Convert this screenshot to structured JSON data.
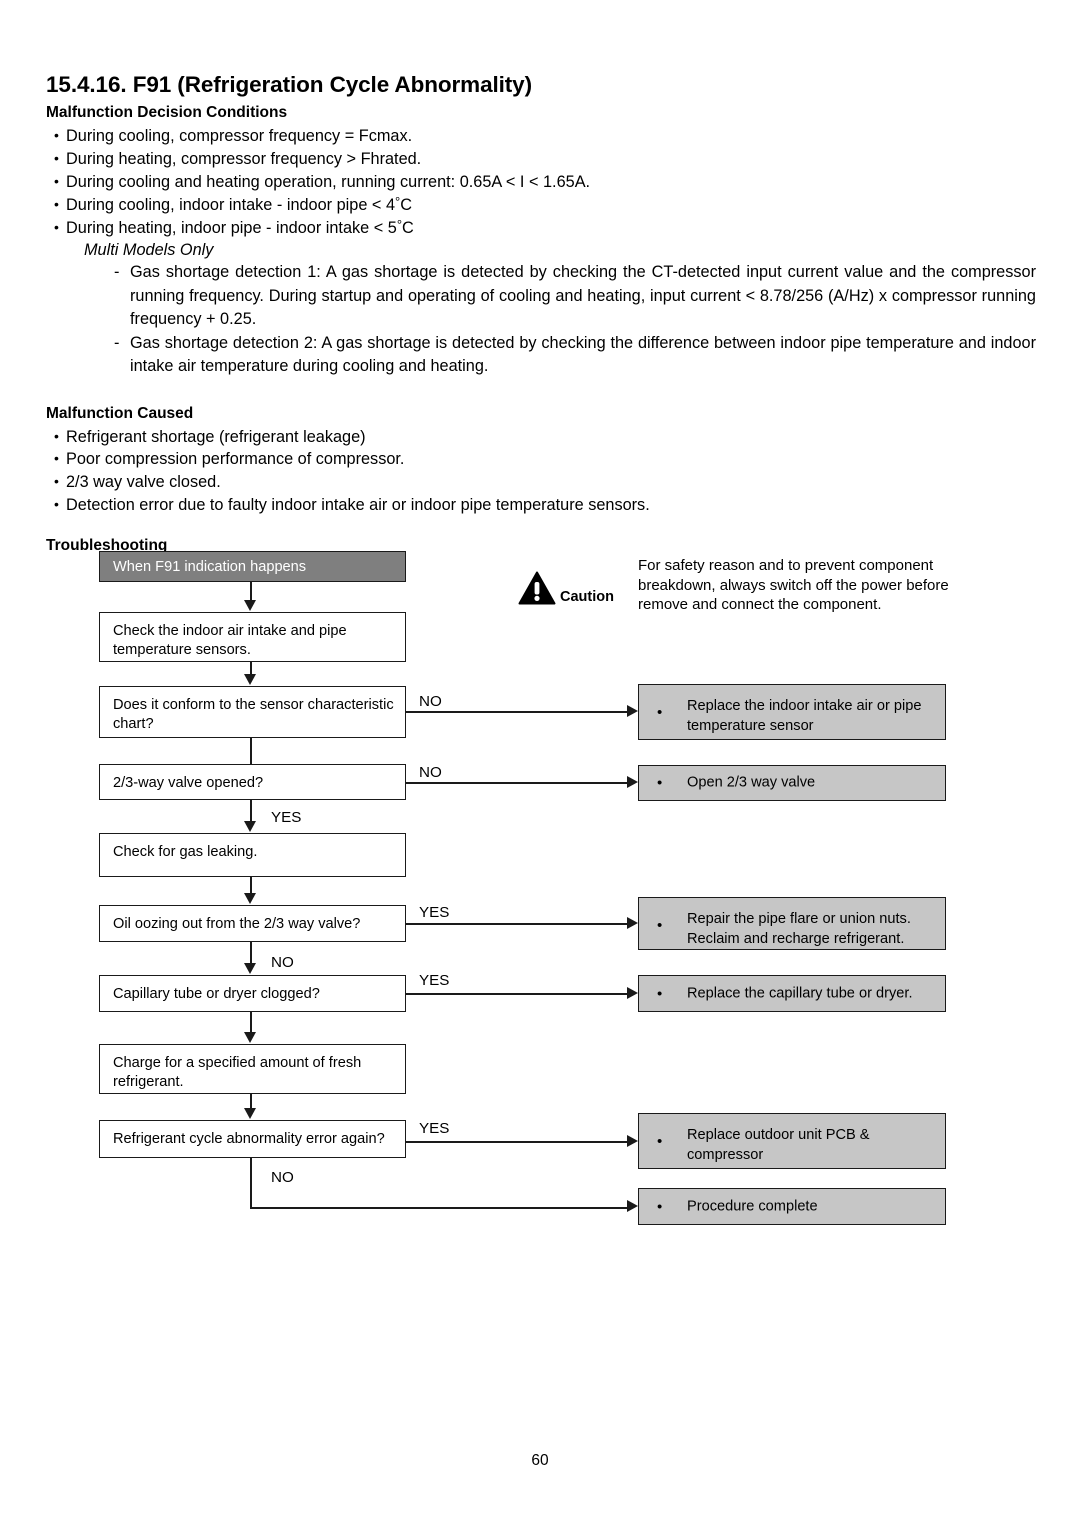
{
  "document": {
    "section_number": "15.4.16.",
    "section_title": "F91 (Refrigeration Cycle Abnormality)",
    "page_number": "60"
  },
  "decision_conditions": {
    "heading": "Malfunction Decision Conditions",
    "bullets": [
      "During cooling, compressor frequency = Fcmax.",
      "During heating, compressor frequency > Fhrated.",
      "During cooling and heating operation, running current: 0.65A < I < 1.65A."
    ],
    "temp_bullets": [
      {
        "pre": "During cooling, indoor intake - indoor pipe < 4",
        "deg": "°",
        "post": "C"
      },
      {
        "pre": "During heating, indoor pipe - indoor intake < 5",
        "deg": "°",
        "post": "C"
      }
    ],
    "multi_models_label": "Multi Models Only",
    "details": [
      "Gas shortage detection 1: A gas shortage is detected by checking the CT-detected input current value and the compressor running frequency. During startup and operating of cooling and heating, input current < 8.78/256 (A/Hz) x compressor running frequency + 0.25.",
      "Gas shortage detection 2: A gas shortage is detected by checking the difference between indoor pipe temperature and indoor intake air temperature during cooling and heating."
    ]
  },
  "malfunction_caused": {
    "heading": "Malfunction Caused",
    "bullets": [
      "Refrigerant shortage (refrigerant leakage)",
      "Poor compression performance of compressor.",
      "2/3 way valve closed.",
      "Detection error due to faulty indoor intake air or indoor pipe temperature sensors."
    ]
  },
  "troubleshooting": {
    "heading": "Troubleshooting",
    "caution": {
      "label": "Caution",
      "text": "For safety reason and to prevent component breakdown, always switch off the power before remove and connect the component."
    },
    "nodes": {
      "start": "When F91 indication happens",
      "check_sensors": "Check the indoor air intake and pipe temperature sensors.",
      "conform_chart": "Does it conform to the sensor characteristic chart?",
      "valve_opened": "2/3-way valve opened?",
      "check_gas_leak": "Check for gas leaking.",
      "oil_oozing": "Oil oozing out from the 2/3 way valve?",
      "capillary_clogged": "Capillary tube or dryer clogged?",
      "charge_refrigerant": "Charge for a specified amount of fresh refrigerant.",
      "error_again": "Refrigerant cycle abnormality error again?"
    },
    "actions": {
      "replace_sensor_line1": "Replace the indoor intake air or pipe",
      "replace_sensor_line2": "temperature sensor",
      "open_valve": "Open 2/3 way valve",
      "repair_flare_line1": "Repair the pipe flare or union nuts.",
      "repair_flare_line2": "Reclaim and recharge refrigerant.",
      "replace_capillary": "Replace the capillary tube or dryer.",
      "replace_pcb_line1": "Replace outdoor unit PCB &",
      "replace_pcb_line2": "compressor",
      "procedure_complete": "Procedure complete"
    },
    "edge_labels": {
      "no_1": "NO",
      "no_2": "NO",
      "yes_1": "YES",
      "yes_2": "YES",
      "no_3": "NO",
      "yes_3": "YES",
      "yes_4": "YES",
      "no_4": "NO"
    },
    "bullet_glyph": "•"
  }
}
